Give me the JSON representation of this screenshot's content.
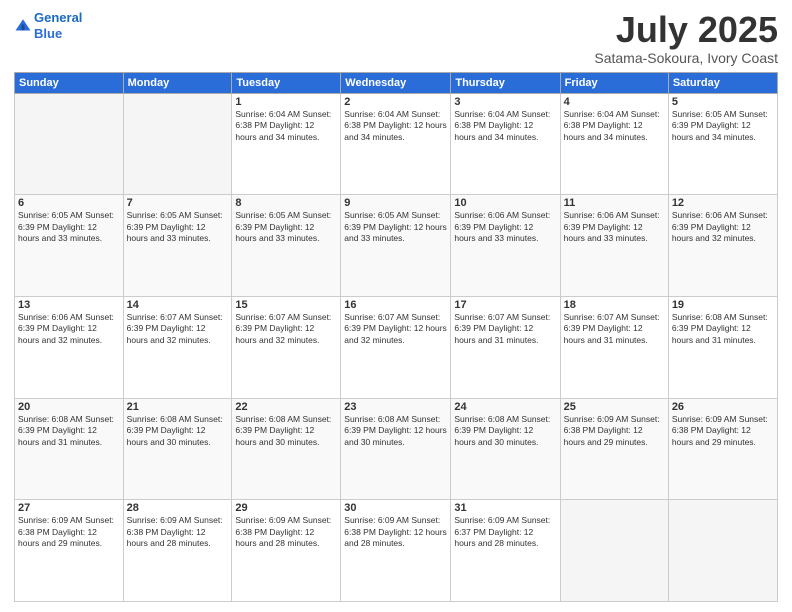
{
  "header": {
    "logo_line1": "General",
    "logo_line2": "Blue",
    "month": "July 2025",
    "location": "Satama-Sokoura, Ivory Coast"
  },
  "weekdays": [
    "Sunday",
    "Monday",
    "Tuesday",
    "Wednesday",
    "Thursday",
    "Friday",
    "Saturday"
  ],
  "weeks": [
    [
      {
        "day": "",
        "info": ""
      },
      {
        "day": "",
        "info": ""
      },
      {
        "day": "1",
        "info": "Sunrise: 6:04 AM\nSunset: 6:38 PM\nDaylight: 12 hours and 34 minutes."
      },
      {
        "day": "2",
        "info": "Sunrise: 6:04 AM\nSunset: 6:38 PM\nDaylight: 12 hours and 34 minutes."
      },
      {
        "day": "3",
        "info": "Sunrise: 6:04 AM\nSunset: 6:38 PM\nDaylight: 12 hours and 34 minutes."
      },
      {
        "day": "4",
        "info": "Sunrise: 6:04 AM\nSunset: 6:38 PM\nDaylight: 12 hours and 34 minutes."
      },
      {
        "day": "5",
        "info": "Sunrise: 6:05 AM\nSunset: 6:39 PM\nDaylight: 12 hours and 34 minutes."
      }
    ],
    [
      {
        "day": "6",
        "info": "Sunrise: 6:05 AM\nSunset: 6:39 PM\nDaylight: 12 hours and 33 minutes."
      },
      {
        "day": "7",
        "info": "Sunrise: 6:05 AM\nSunset: 6:39 PM\nDaylight: 12 hours and 33 minutes."
      },
      {
        "day": "8",
        "info": "Sunrise: 6:05 AM\nSunset: 6:39 PM\nDaylight: 12 hours and 33 minutes."
      },
      {
        "day": "9",
        "info": "Sunrise: 6:05 AM\nSunset: 6:39 PM\nDaylight: 12 hours and 33 minutes."
      },
      {
        "day": "10",
        "info": "Sunrise: 6:06 AM\nSunset: 6:39 PM\nDaylight: 12 hours and 33 minutes."
      },
      {
        "day": "11",
        "info": "Sunrise: 6:06 AM\nSunset: 6:39 PM\nDaylight: 12 hours and 33 minutes."
      },
      {
        "day": "12",
        "info": "Sunrise: 6:06 AM\nSunset: 6:39 PM\nDaylight: 12 hours and 32 minutes."
      }
    ],
    [
      {
        "day": "13",
        "info": "Sunrise: 6:06 AM\nSunset: 6:39 PM\nDaylight: 12 hours and 32 minutes."
      },
      {
        "day": "14",
        "info": "Sunrise: 6:07 AM\nSunset: 6:39 PM\nDaylight: 12 hours and 32 minutes."
      },
      {
        "day": "15",
        "info": "Sunrise: 6:07 AM\nSunset: 6:39 PM\nDaylight: 12 hours and 32 minutes."
      },
      {
        "day": "16",
        "info": "Sunrise: 6:07 AM\nSunset: 6:39 PM\nDaylight: 12 hours and 32 minutes."
      },
      {
        "day": "17",
        "info": "Sunrise: 6:07 AM\nSunset: 6:39 PM\nDaylight: 12 hours and 31 minutes."
      },
      {
        "day": "18",
        "info": "Sunrise: 6:07 AM\nSunset: 6:39 PM\nDaylight: 12 hours and 31 minutes."
      },
      {
        "day": "19",
        "info": "Sunrise: 6:08 AM\nSunset: 6:39 PM\nDaylight: 12 hours and 31 minutes."
      }
    ],
    [
      {
        "day": "20",
        "info": "Sunrise: 6:08 AM\nSunset: 6:39 PM\nDaylight: 12 hours and 31 minutes."
      },
      {
        "day": "21",
        "info": "Sunrise: 6:08 AM\nSunset: 6:39 PM\nDaylight: 12 hours and 30 minutes."
      },
      {
        "day": "22",
        "info": "Sunrise: 6:08 AM\nSunset: 6:39 PM\nDaylight: 12 hours and 30 minutes."
      },
      {
        "day": "23",
        "info": "Sunrise: 6:08 AM\nSunset: 6:39 PM\nDaylight: 12 hours and 30 minutes."
      },
      {
        "day": "24",
        "info": "Sunrise: 6:08 AM\nSunset: 6:39 PM\nDaylight: 12 hours and 30 minutes."
      },
      {
        "day": "25",
        "info": "Sunrise: 6:09 AM\nSunset: 6:38 PM\nDaylight: 12 hours and 29 minutes."
      },
      {
        "day": "26",
        "info": "Sunrise: 6:09 AM\nSunset: 6:38 PM\nDaylight: 12 hours and 29 minutes."
      }
    ],
    [
      {
        "day": "27",
        "info": "Sunrise: 6:09 AM\nSunset: 6:38 PM\nDaylight: 12 hours and 29 minutes."
      },
      {
        "day": "28",
        "info": "Sunrise: 6:09 AM\nSunset: 6:38 PM\nDaylight: 12 hours and 28 minutes."
      },
      {
        "day": "29",
        "info": "Sunrise: 6:09 AM\nSunset: 6:38 PM\nDaylight: 12 hours and 28 minutes."
      },
      {
        "day": "30",
        "info": "Sunrise: 6:09 AM\nSunset: 6:38 PM\nDaylight: 12 hours and 28 minutes."
      },
      {
        "day": "31",
        "info": "Sunrise: 6:09 AM\nSunset: 6:37 PM\nDaylight: 12 hours and 28 minutes."
      },
      {
        "day": "",
        "info": ""
      },
      {
        "day": "",
        "info": ""
      }
    ]
  ]
}
